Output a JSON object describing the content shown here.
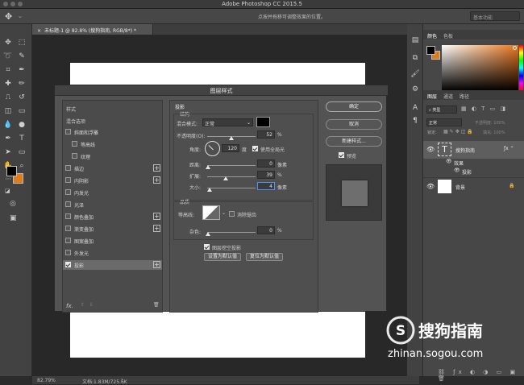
{
  "app": {
    "title": "Adobe Photoshop CC 2015.5"
  },
  "options_bar": {
    "hint": "点按并拖移可调整效果的位置。",
    "workspace": "基本功能"
  },
  "document": {
    "tab": "未标题-1 @ 82.8% (搜狗指南, RGB/8*) *"
  },
  "status": {
    "zoom": "82.79%",
    "doc_size": "文档:1.83M/725.6K"
  },
  "dialog": {
    "title": "图层样式",
    "styles_header": "样式",
    "blend_options": "混合选项",
    "items": [
      {
        "label": "斜面和浮雕",
        "checked": false,
        "plus": false
      },
      {
        "label": "等高线",
        "checked": false,
        "plus": false
      },
      {
        "label": "纹理",
        "checked": false,
        "plus": false
      },
      {
        "label": "描边",
        "checked": false,
        "plus": true
      },
      {
        "label": "内阴影",
        "checked": false,
        "plus": true
      },
      {
        "label": "内发光",
        "checked": false,
        "plus": false
      },
      {
        "label": "光泽",
        "checked": false,
        "plus": false
      },
      {
        "label": "颜色叠加",
        "checked": false,
        "plus": true
      },
      {
        "label": "渐变叠加",
        "checked": false,
        "plus": true
      },
      {
        "label": "图案叠加",
        "checked": false,
        "plus": false
      },
      {
        "label": "外发光",
        "checked": false,
        "plus": false
      },
      {
        "label": "投影",
        "checked": true,
        "plus": true
      }
    ],
    "fx": "fx.",
    "section": "投影",
    "structure": "结构",
    "blend_mode_label": "混合模式:",
    "blend_mode_value": "正常",
    "opacity_label": "不透明度(O):",
    "opacity_value": "52",
    "angle_label": "角度:",
    "angle_value": "120",
    "degree": "度",
    "global_light": "使用全局光",
    "distance_label": "距离:",
    "distance_value": "0",
    "spread_label": "扩展:",
    "spread_value": "39",
    "size_label": "大小:",
    "size_value": "4",
    "pixel": "像素",
    "percent": "%",
    "quality": "品质",
    "contour_label": "等高线:",
    "antialias": "消除锯齿",
    "noise_label": "杂色:",
    "noise_value": "0",
    "knockout": "图层挖空投影",
    "set_default": "设置为默认值",
    "reset_default": "复位为默认值",
    "ok": "确定",
    "cancel": "取消",
    "new_style": "新建样式...",
    "preview": "预览",
    "shadow_color": "#000000"
  },
  "right_panel": {
    "tabs_top": [
      "颜色",
      "色板"
    ],
    "tabs_layers": [
      "图层",
      "通道",
      "路径"
    ],
    "kind_label": "类型",
    "blend": "正常",
    "opacity": "不透明度: 100%",
    "lock_label": "锁定:",
    "fill": "填充: 100%",
    "layers": [
      {
        "name": "搜狗指南",
        "type": "text"
      },
      {
        "name": "效果",
        "type": "sub"
      },
      {
        "name": "投影",
        "type": "sub"
      },
      {
        "name": "背景",
        "type": "bg"
      }
    ]
  },
  "watermark": {
    "brand": "搜狗指南",
    "url": "zhinan.sogou.com"
  },
  "colors": {
    "accent": "#e07b1a",
    "panel": "#474747",
    "dialog": "#535353"
  }
}
